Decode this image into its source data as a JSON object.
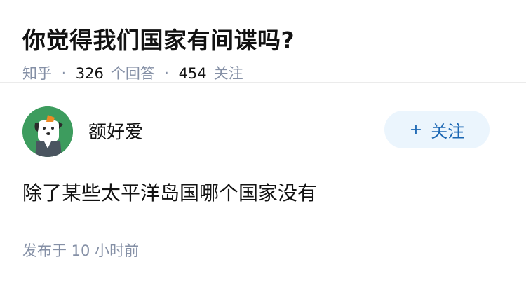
{
  "question": {
    "title": "你觉得我们国家有间谍吗?",
    "source": "知乎",
    "answer_count": "326",
    "answer_label": "个回答",
    "follow_count": "454",
    "follow_label": "关注"
  },
  "answer": {
    "author_name": "额好爱",
    "follow_button_plus": "+",
    "follow_button_label": "关注",
    "content": "除了某些太平洋岛国哪个国家没有",
    "time": "发布于 10 小时前"
  },
  "colors": {
    "title": "#121212",
    "meta": "#8590a6",
    "follow_bg": "#ebf5fd",
    "follow_text": "#1a66b3",
    "avatar_bg": "#3d9c5e"
  },
  "icons": {
    "avatar": "dog-avatar-icon"
  }
}
